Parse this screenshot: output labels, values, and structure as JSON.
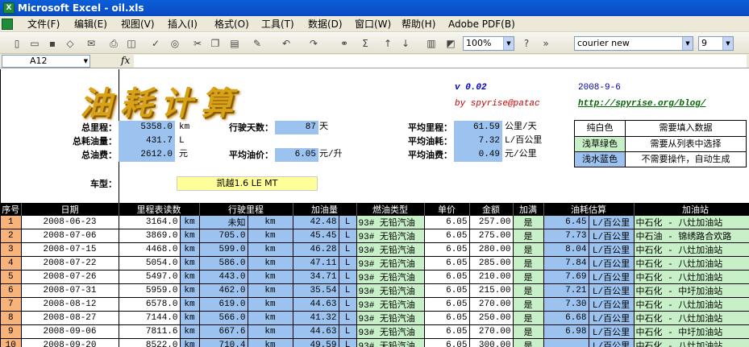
{
  "window": {
    "title": "Microsoft Excel - oil.xls"
  },
  "menu": [
    "文件(F)",
    "编辑(E)",
    "视图(V)",
    "插入(I)",
    "格式(O)",
    "工具(T)",
    "数据(D)",
    "窗口(W)",
    "帮助(H)",
    "Adobe PDF(B)"
  ],
  "toolbar": {
    "zoom": "100%",
    "font": "courier new",
    "font_size": "9"
  },
  "formula": {
    "cell_ref": "A12",
    "fx": "fx",
    "content": ""
  },
  "header": {
    "title": "油耗计算",
    "version": "v 0.02",
    "date": "2008-9-6",
    "author": "by spyrise@patac",
    "blog": "http://spyrise.org/blog/"
  },
  "summary": {
    "total_distance_label": "总里程：",
    "total_distance": "5358.0",
    "total_distance_unit": "km",
    "total_fuel_label": "总耗油量：",
    "total_fuel": "431.7",
    "total_fuel_unit": "L",
    "total_cost_label": "总油费：",
    "total_cost": "2612.0",
    "total_cost_unit": "元",
    "days_label": "行驶天数：",
    "days": "87",
    "days_unit": "天",
    "avg_price_label": "平均油价：",
    "avg_price": "6.05",
    "avg_price_unit": "元/升",
    "avg_distance_label": "平均里程：",
    "avg_distance": "61.59",
    "avg_distance_unit": "公里/天",
    "avg_consumption_label": "平均油耗：",
    "avg_consumption": "7.32",
    "avg_consumption_unit": "L/百公里",
    "avg_cost_label": "平均油费：",
    "avg_cost": "0.49",
    "avg_cost_unit": "元/公里",
    "car_type_label": "车型：",
    "car_type": "凯越1.6 LE MT"
  },
  "legend": [
    {
      "color_name": "纯白色",
      "desc": "需要填入数据",
      "color": "#ffffff"
    },
    {
      "color_name": "浅草绿色",
      "desc": "需要从列表中选择",
      "color": "#c8f0c8"
    },
    {
      "color_name": "浅水蓝色",
      "desc": "不需要操作，自动生成",
      "color": "#9cc3f0"
    }
  ],
  "table": {
    "headers": [
      "序号",
      "日期",
      "里程表读数",
      "行驶里程",
      "加油量",
      "燃油类型",
      "单价",
      "金额",
      "加满",
      "油耗估算",
      "加油站"
    ],
    "rows": [
      {
        "idx": "1",
        "date": "2008-06-23",
        "odo": "3164.0",
        "odo_u": "km",
        "dist": "未知",
        "dist_u": "km",
        "fuel": "42.48",
        "fuel_u": "L",
        "type": "93# 无铅汽油",
        "price": "6.05",
        "amount": "257.00",
        "full": "是",
        "cons": "6.45",
        "cons_u": "L/百公里",
        "station": "中石化 - 八灶加油站"
      },
      {
        "idx": "2",
        "date": "2008-07-06",
        "odo": "3869.0",
        "odo_u": "km",
        "dist": "705.0",
        "dist_u": "km",
        "fuel": "45.45",
        "fuel_u": "L",
        "type": "93# 无铅汽油",
        "price": "6.05",
        "amount": "275.00",
        "full": "是",
        "cons": "7.73",
        "cons_u": "L/百公里",
        "station": "中石油 - 锦绣路合欢路"
      },
      {
        "idx": "3",
        "date": "2008-07-15",
        "odo": "4468.0",
        "odo_u": "km",
        "dist": "599.0",
        "dist_u": "km",
        "fuel": "46.28",
        "fuel_u": "L",
        "type": "93# 无铅汽油",
        "price": "6.05",
        "amount": "280.00",
        "full": "是",
        "cons": "8.04",
        "cons_u": "L/百公里",
        "station": "中石化 - 八灶加油站"
      },
      {
        "idx": "4",
        "date": "2008-07-22",
        "odo": "5054.0",
        "odo_u": "km",
        "dist": "586.0",
        "dist_u": "km",
        "fuel": "47.11",
        "fuel_u": "L",
        "type": "93# 无铅汽油",
        "price": "6.05",
        "amount": "285.00",
        "full": "是",
        "cons": "7.84",
        "cons_u": "L/百公里",
        "station": "中石化 - 八灶加油站"
      },
      {
        "idx": "5",
        "date": "2008-07-26",
        "odo": "5497.0",
        "odo_u": "km",
        "dist": "443.0",
        "dist_u": "km",
        "fuel": "34.71",
        "fuel_u": "L",
        "type": "93# 无铅汽油",
        "price": "6.05",
        "amount": "210.00",
        "full": "是",
        "cons": "7.69",
        "cons_u": "L/百公里",
        "station": "中石化 - 八灶加油站"
      },
      {
        "idx": "6",
        "date": "2008-07-31",
        "odo": "5959.0",
        "odo_u": "km",
        "dist": "462.0",
        "dist_u": "km",
        "fuel": "35.54",
        "fuel_u": "L",
        "type": "93# 无铅汽油",
        "price": "6.05",
        "amount": "215.00",
        "full": "是",
        "cons": "7.21",
        "cons_u": "L/百公里",
        "station": "中石化 - 中圩加油站"
      },
      {
        "idx": "7",
        "date": "2008-08-12",
        "odo": "6578.0",
        "odo_u": "km",
        "dist": "619.0",
        "dist_u": "km",
        "fuel": "44.63",
        "fuel_u": "L",
        "type": "93# 无铅汽油",
        "price": "6.05",
        "amount": "270.00",
        "full": "是",
        "cons": "7.30",
        "cons_u": "L/百公里",
        "station": "中石化 - 八灶加油站"
      },
      {
        "idx": "8",
        "date": "2008-08-27",
        "odo": "7144.0",
        "odo_u": "km",
        "dist": "566.0",
        "dist_u": "km",
        "fuel": "41.32",
        "fuel_u": "L",
        "type": "93# 无铅汽油",
        "price": "6.05",
        "amount": "250.00",
        "full": "是",
        "cons": "6.68",
        "cons_u": "L/百公里",
        "station": "中石化 - 八灶加油站"
      },
      {
        "idx": "9",
        "date": "2008-09-06",
        "odo": "7811.6",
        "odo_u": "km",
        "dist": "667.6",
        "dist_u": "km",
        "fuel": "44.63",
        "fuel_u": "L",
        "type": "93# 无铅汽油",
        "price": "6.05",
        "amount": "270.00",
        "full": "是",
        "cons": "6.98",
        "cons_u": "L/百公里",
        "station": "中石化 - 中圩加油站"
      },
      {
        "idx": "10",
        "date": "2008-09-20",
        "odo": "8522.0",
        "odo_u": "km",
        "dist": "710.4",
        "dist_u": "km",
        "fuel": "49.59",
        "fuel_u": "L",
        "type": "93# 无铅汽油",
        "price": "6.05",
        "amount": "300.00",
        "full": "是",
        "cons": "",
        "cons_u": "L/百公里",
        "station": "中石化 - 八灶加油站"
      }
    ]
  }
}
